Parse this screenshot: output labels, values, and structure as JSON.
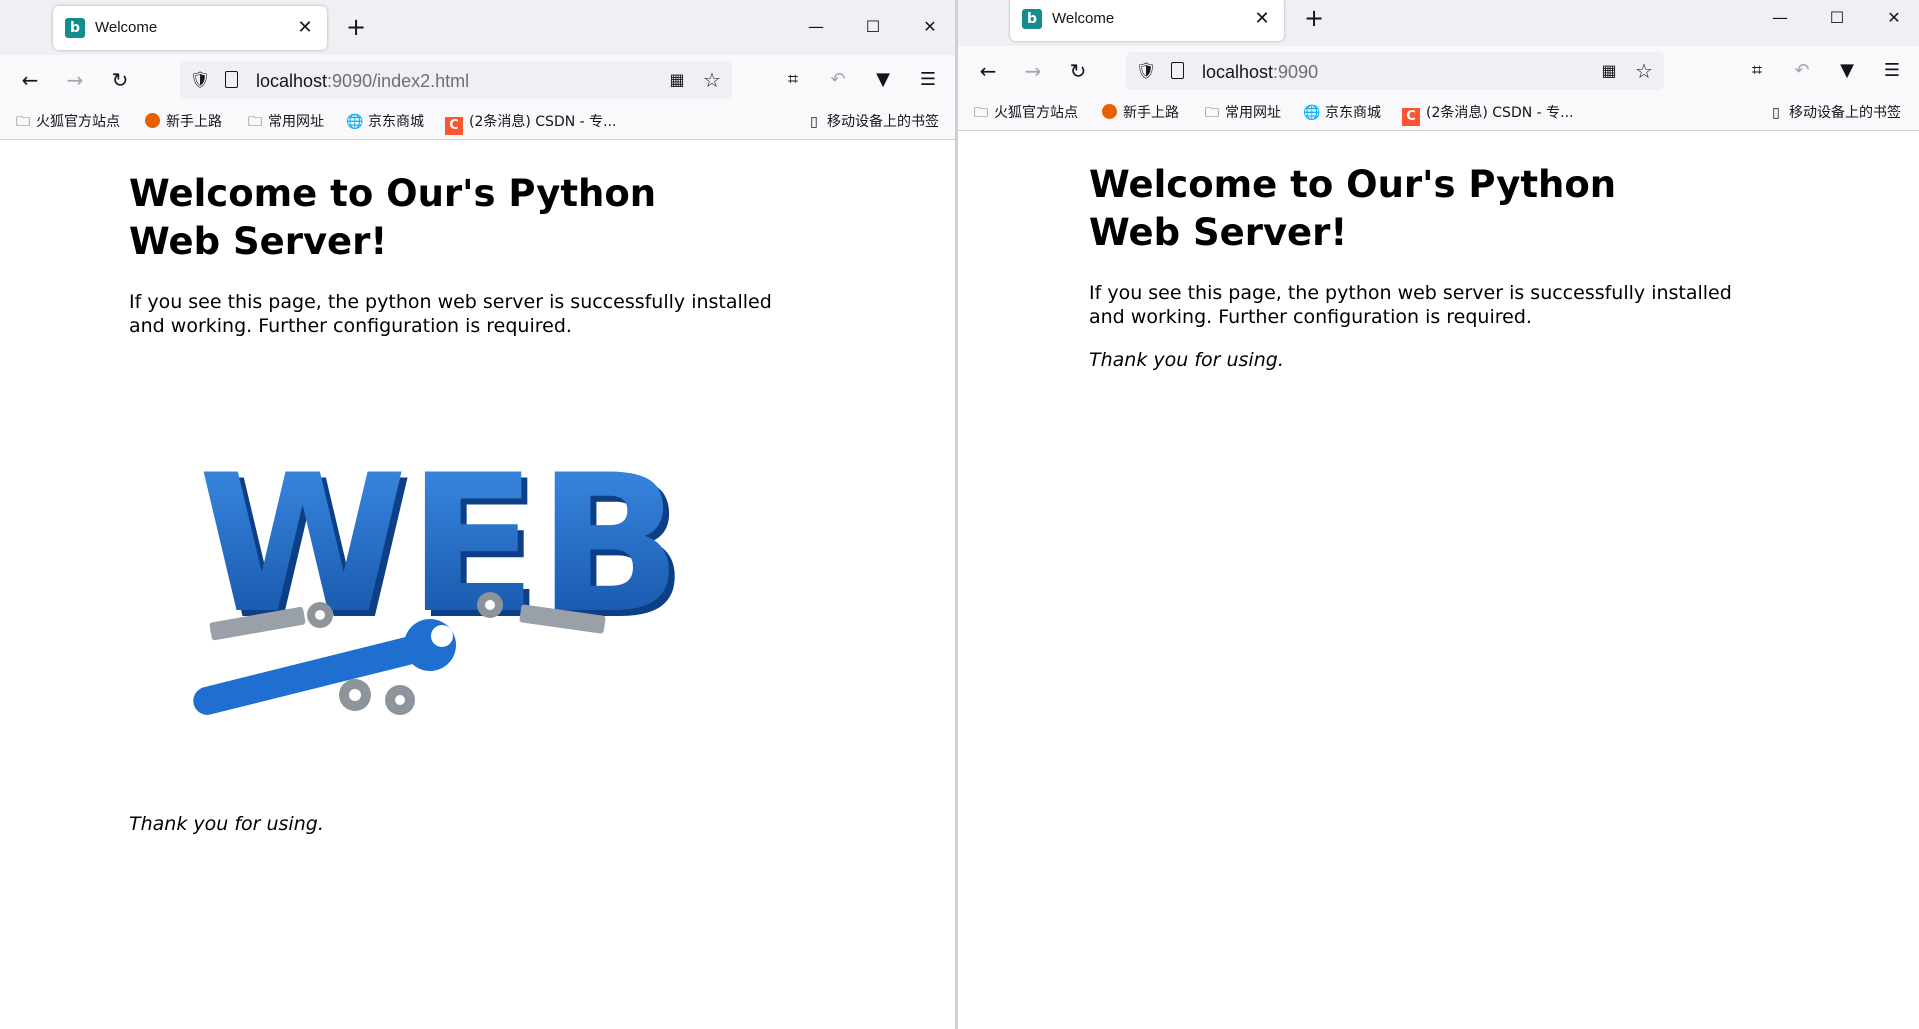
{
  "bookmarks": [
    {
      "label": "火狐官方站点"
    },
    {
      "label": "新手上路"
    },
    {
      "label": "常用网址"
    },
    {
      "label": "京东商城"
    },
    {
      "label": "(2条消息) CSDN - 专..."
    }
  ],
  "bookmarks_mobile": "移动设备上的书签",
  "left_window": {
    "tab_title": "Welcome",
    "url_host": "localhost",
    "url_rest": ":9090/index2.html",
    "page": {
      "heading": "Welcome to Our's Python Web Server!",
      "paragraph": "If you see this page, the python web server is successfully installed and working. Further configuration is required.",
      "image_text": "WEB",
      "thanks": "Thank you for using."
    }
  },
  "right_window": {
    "tab_title": "Welcome",
    "url_host": "localhost",
    "url_rest": ":9090",
    "page": {
      "heading": "Welcome to Our's Python Web Server!",
      "paragraph": "If you see this page, the python web server is successfully installed and working. Further configuration is required.",
      "thanks": "Thank you for using."
    }
  },
  "colors": {
    "favicon": "#138c8e",
    "web_blue": "#1f6fd1",
    "csdn": "#fc5531",
    "firefox": "#e66000"
  },
  "icons": [
    "bing-favicon",
    "close-icon",
    "plus-icon",
    "minimize-icon",
    "maximize-icon",
    "back-icon",
    "forward-icon",
    "reload-icon",
    "shield-icon",
    "page-icon",
    "qr-code-icon",
    "star-icon",
    "screenshot-icon",
    "undo-icon",
    "vivaldi-icon",
    "menu-icon",
    "folder-icon",
    "globe-icon",
    "mobile-icon"
  ]
}
